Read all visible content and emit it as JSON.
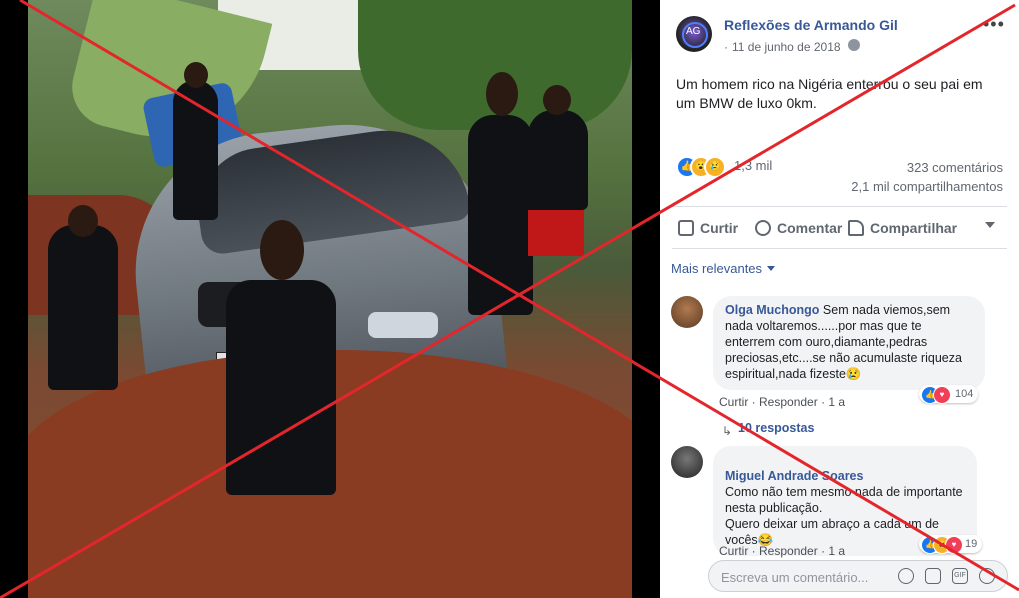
{
  "post": {
    "page_name": "Reflexões de Armando Gil",
    "date": "11 de junho de 2018",
    "dot": "·",
    "avatar_text": "AG",
    "text": "Um homem rico na Nigéria enterrou o seu pai em um BMW de luxo 0km.",
    "reactions_count": "1,3 mil",
    "comments_count": "323 comentários",
    "shares_count": "2,1 mil compartilhamentos"
  },
  "actions": {
    "like": "Curtir",
    "comment": "Comentar",
    "share": "Compartilhar"
  },
  "comments_filter": "Mais relevantes",
  "comments": [
    {
      "author": "Olga Muchongo",
      "text": "Sem nada viemos,sem nada voltaremos......por mas que te enterrem com ouro,diamante,pedras preciosas,etc....se não acumulaste riqueza espiritual,nada fizeste😢",
      "like_label": "Curtir",
      "reply_label": "Responder",
      "time": "1 a",
      "reaction_count": "104"
    },
    {
      "author": "Miguel Andrade Soares",
      "text": "Como não tem mesmo nada de importante nesta publicação.\nQuero deixar um abraço a cada um de vocês😂",
      "like_label": "Curtir",
      "reply_label": "Responder",
      "time": "1 a",
      "reaction_count": "19"
    }
  ],
  "replies_link": "10 respostas",
  "composer": {
    "placeholder": "Escreva um comentário..."
  },
  "colors": {
    "link_blue": "#385898",
    "cross_red": "#e3262b",
    "like_blue": "#1877f2",
    "reaction_yellow": "#f7b125",
    "love_red": "#f33e58"
  }
}
